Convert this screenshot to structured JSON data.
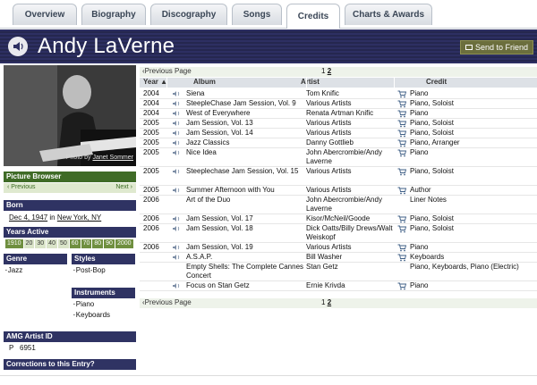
{
  "tabs": [
    {
      "label": "Overview",
      "active": false
    },
    {
      "label": "Biography",
      "active": false
    },
    {
      "label": "Discography",
      "active": false
    },
    {
      "label": "Songs",
      "active": false
    },
    {
      "label": "Credits",
      "active": true
    },
    {
      "label": "Charts & Awards",
      "active": false
    }
  ],
  "header": {
    "artist_name": "Andy LaVerne",
    "send_label": "Send to Friend"
  },
  "sidebar": {
    "photo_credit_prefix": "Photo by",
    "photo_credit_name": "Janet Sommer",
    "picture_browser": {
      "title": "Picture Browser",
      "prev": "‹ Previous",
      "next": "Next ›"
    },
    "born": {
      "title": "Born",
      "date": "Dec 4, 1947",
      "in": "in",
      "place": "New York, NY"
    },
    "years_active": {
      "title": "Years Active",
      "decades": [
        {
          "label": "1910",
          "on": true
        },
        {
          "label": "20",
          "on": false
        },
        {
          "label": "30",
          "on": false
        },
        {
          "label": "40",
          "on": false
        },
        {
          "label": "50",
          "on": false
        },
        {
          "label": "60",
          "on": true
        },
        {
          "label": "70",
          "on": true
        },
        {
          "label": "80",
          "on": true
        },
        {
          "label": "90",
          "on": true
        },
        {
          "label": "2000",
          "on": true
        }
      ]
    },
    "genre": {
      "title": "Genre",
      "items": [
        "Jazz"
      ]
    },
    "styles": {
      "title": "Styles",
      "items": [
        "Post-Bop"
      ]
    },
    "instruments": {
      "title": "Instruments",
      "items": [
        "Piano",
        "Keyboards"
      ]
    },
    "amg": {
      "title": "AMG Artist ID",
      "prefix": "P",
      "id": "6951"
    },
    "corrections": {
      "title": "Corrections to this Entry?"
    }
  },
  "pager": {
    "prev": "‹Previous Page",
    "page1": "1",
    "page2": "2"
  },
  "table": {
    "headers": {
      "year": "Year ▲",
      "album": "Album",
      "artist": "Artist",
      "credit": "Credit"
    },
    "rows": [
      {
        "year": "2004",
        "album": "Siena",
        "artist": "Tom Knific",
        "credit": "Piano",
        "sound": true,
        "cart": true
      },
      {
        "year": "2004",
        "album": "SteepleChase Jam Session, Vol. 9",
        "artist": "Various Artists",
        "credit": "Piano, Soloist",
        "sound": true,
        "cart": true
      },
      {
        "year": "2004",
        "album": "West of Everywhere",
        "artist": "Renata Artman Knific",
        "credit": "Piano",
        "sound": true,
        "cart": true
      },
      {
        "year": "2005",
        "album": "Jam Session, Vol. 13",
        "artist": "Various Artists",
        "credit": "Piano, Soloist",
        "sound": true,
        "cart": true
      },
      {
        "year": "2005",
        "album": "Jam Session, Vol. 14",
        "artist": "Various Artists",
        "credit": "Piano, Soloist",
        "sound": true,
        "cart": true
      },
      {
        "year": "2005",
        "album": "Jazz Classics",
        "artist": "Danny Gottlieb",
        "credit": "Piano, Arranger",
        "sound": true,
        "cart": true
      },
      {
        "year": "2005",
        "album": "Nice Idea",
        "artist": "John Abercrombie/Andy Laverne",
        "credit": "Piano",
        "sound": true,
        "cart": true
      },
      {
        "year": "2005",
        "album": "Steeplechase Jam Session, Vol. 15",
        "artist": "Various Artists",
        "credit": "Piano, Soloist",
        "sound": true,
        "cart": true
      },
      {
        "year": "2005",
        "album": "Summer Afternoon with You",
        "artist": "Various Artists",
        "credit": "Author",
        "sound": true,
        "cart": true
      },
      {
        "year": "2006",
        "album": "Art of the Duo",
        "artist": "John Abercrombie/Andy Laverne",
        "credit": "Liner Notes",
        "sound": false,
        "cart": false
      },
      {
        "year": "2006",
        "album": "Jam Session, Vol. 17",
        "artist": "Kisor/McNeil/Goode",
        "credit": "Piano, Soloist",
        "sound": true,
        "cart": true
      },
      {
        "year": "2006",
        "album": "Jam Session, Vol. 18",
        "artist": "Dick Oatts/Billy Drews/Walt Weiskopf",
        "credit": "Piano, Soloist",
        "sound": true,
        "cart": true
      },
      {
        "year": "2006",
        "album": "Jam Session, Vol. 19",
        "artist": "Various Artists",
        "credit": "Piano",
        "sound": true,
        "cart": true
      },
      {
        "year": "",
        "album": "A.S.A.P.",
        "artist": "Bill Washer",
        "credit": "Keyboards",
        "sound": true,
        "cart": true
      },
      {
        "year": "",
        "album": "Empty Shells: The Complete Cannes Concert",
        "artist": "Stan Getz",
        "credit": "Piano, Keyboards, Piano (Electric)",
        "sound": false,
        "cart": false
      },
      {
        "year": "",
        "album": "Focus on Stan Getz",
        "artist": "Ernie Krivda",
        "credit": "Piano",
        "sound": true,
        "cart": true
      }
    ]
  },
  "colors": {
    "header_bg": "#2d2f62",
    "sidebar_head": "#2f3363",
    "decade_on": "#6f8f3f",
    "pager_bg": "#eef3ea"
  }
}
